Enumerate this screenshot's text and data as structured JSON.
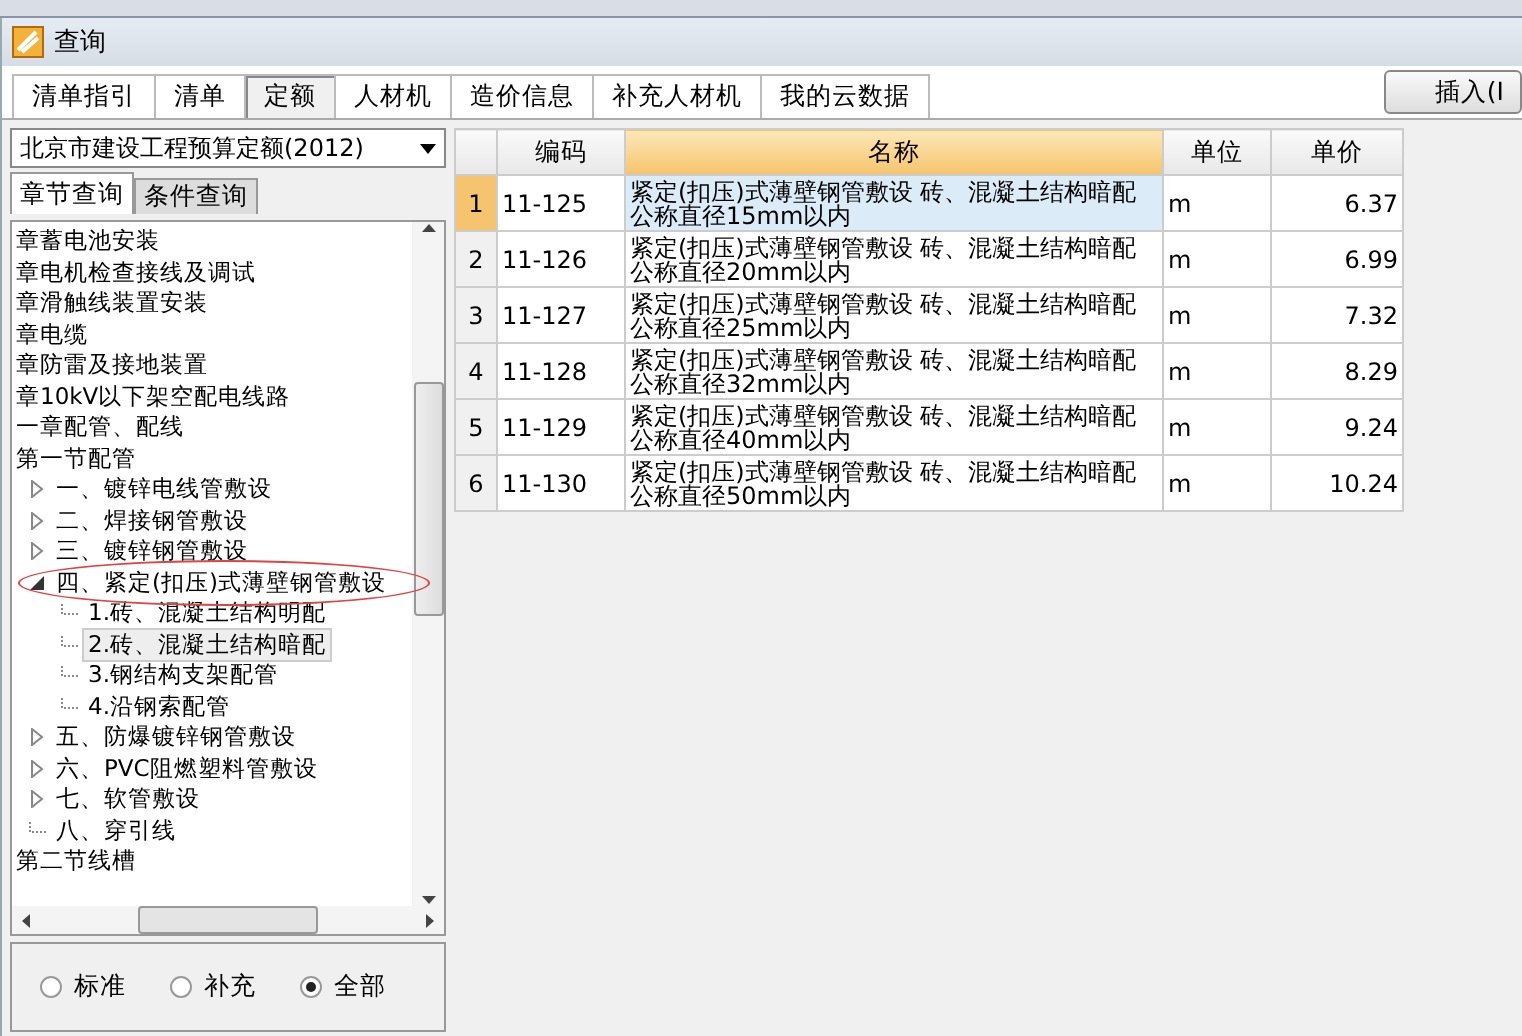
{
  "window": {
    "title": "查询"
  },
  "tabs": [
    {
      "label": "清单指引",
      "selected": false
    },
    {
      "label": "清单",
      "selected": false
    },
    {
      "label": "定额",
      "selected": true
    },
    {
      "label": "人材机",
      "selected": false
    },
    {
      "label": "造价信息",
      "selected": false
    },
    {
      "label": "补充人材机",
      "selected": false
    },
    {
      "label": "我的云数据",
      "selected": false
    }
  ],
  "insert_button": "插入(I",
  "quota_dropdown": {
    "value": "北京市建设工程预算定额(2012)"
  },
  "sub_tabs": [
    {
      "label": "章节查询",
      "selected": true
    },
    {
      "label": "条件查询",
      "selected": false
    }
  ],
  "tree": [
    {
      "label": "章蓄电池安装"
    },
    {
      "label": "章电机检查接线及调试"
    },
    {
      "label": "章滑触线装置安装"
    },
    {
      "label": "章电缆"
    },
    {
      "label": "章防雷及接地装置"
    },
    {
      "label": "章10kV以下架空配电线路"
    },
    {
      "label": "一章配管、配线"
    },
    {
      "label": "第一节配管",
      "children": [
        {
          "label": "一、镀锌电线管敷设",
          "expanded": false,
          "selected": false
        },
        {
          "label": "二、焊接钢管敷设",
          "expanded": false,
          "selected": false
        },
        {
          "label": "三、镀锌钢管敷设",
          "expanded": false,
          "selected": false
        },
        {
          "label": "四、紧定(扣压)式薄壁钢管敷设",
          "expanded": true,
          "selected": false,
          "circled": true,
          "children": [
            {
              "label": "1.砖、混凝土结构明配",
              "selected": false
            },
            {
              "label": "2.砖、混凝土结构暗配",
              "selected": true
            },
            {
              "label": "3.钢结构支架配管",
              "selected": false
            },
            {
              "label": "4.沿钢索配管",
              "selected": false
            }
          ]
        },
        {
          "label": "五、防爆镀锌钢管敷设",
          "expanded": false,
          "selected": false
        },
        {
          "label": "六、PVC阻燃塑料管敷设",
          "expanded": false,
          "selected": false
        },
        {
          "label": "七、软管敷设",
          "expanded": false,
          "selected": false
        },
        {
          "label": "八、穿引线",
          "selected": false
        }
      ]
    },
    {
      "label": "第二节线槽"
    }
  ],
  "filter_radios": [
    {
      "label": "标准",
      "selected": false
    },
    {
      "label": "补充",
      "selected": false
    },
    {
      "label": "全部",
      "selected": true
    }
  ],
  "table": {
    "columns": [
      "编码",
      "名称",
      "单位",
      "单价"
    ],
    "rows": [
      {
        "index": "1",
        "code": "11-125",
        "name": "紧定(扣压)式薄壁钢管敷设 砖、混凝土结构暗配公称直径15mm以内",
        "unit": "m",
        "price": "6.37",
        "selected": true
      },
      {
        "index": "2",
        "code": "11-126",
        "name": "紧定(扣压)式薄壁钢管敷设 砖、混凝土结构暗配公称直径20mm以内",
        "unit": "m",
        "price": "6.99",
        "selected": false
      },
      {
        "index": "3",
        "code": "11-127",
        "name": "紧定(扣压)式薄壁钢管敷设 砖、混凝土结构暗配公称直径25mm以内",
        "unit": "m",
        "price": "7.32",
        "selected": false
      },
      {
        "index": "4",
        "code": "11-128",
        "name": "紧定(扣压)式薄壁钢管敷设 砖、混凝土结构暗配公称直径32mm以内",
        "unit": "m",
        "price": "8.29",
        "selected": false
      },
      {
        "index": "5",
        "code": "11-129",
        "name": "紧定(扣压)式薄壁钢管敷设 砖、混凝土结构暗配公称直径40mm以内",
        "unit": "m",
        "price": "9.24",
        "selected": false
      },
      {
        "index": "6",
        "code": "11-130",
        "name": "紧定(扣压)式薄壁钢管敷设 砖、混凝土结构暗配公称直径50mm以内",
        "unit": "m",
        "price": "10.24",
        "selected": false
      }
    ]
  }
}
